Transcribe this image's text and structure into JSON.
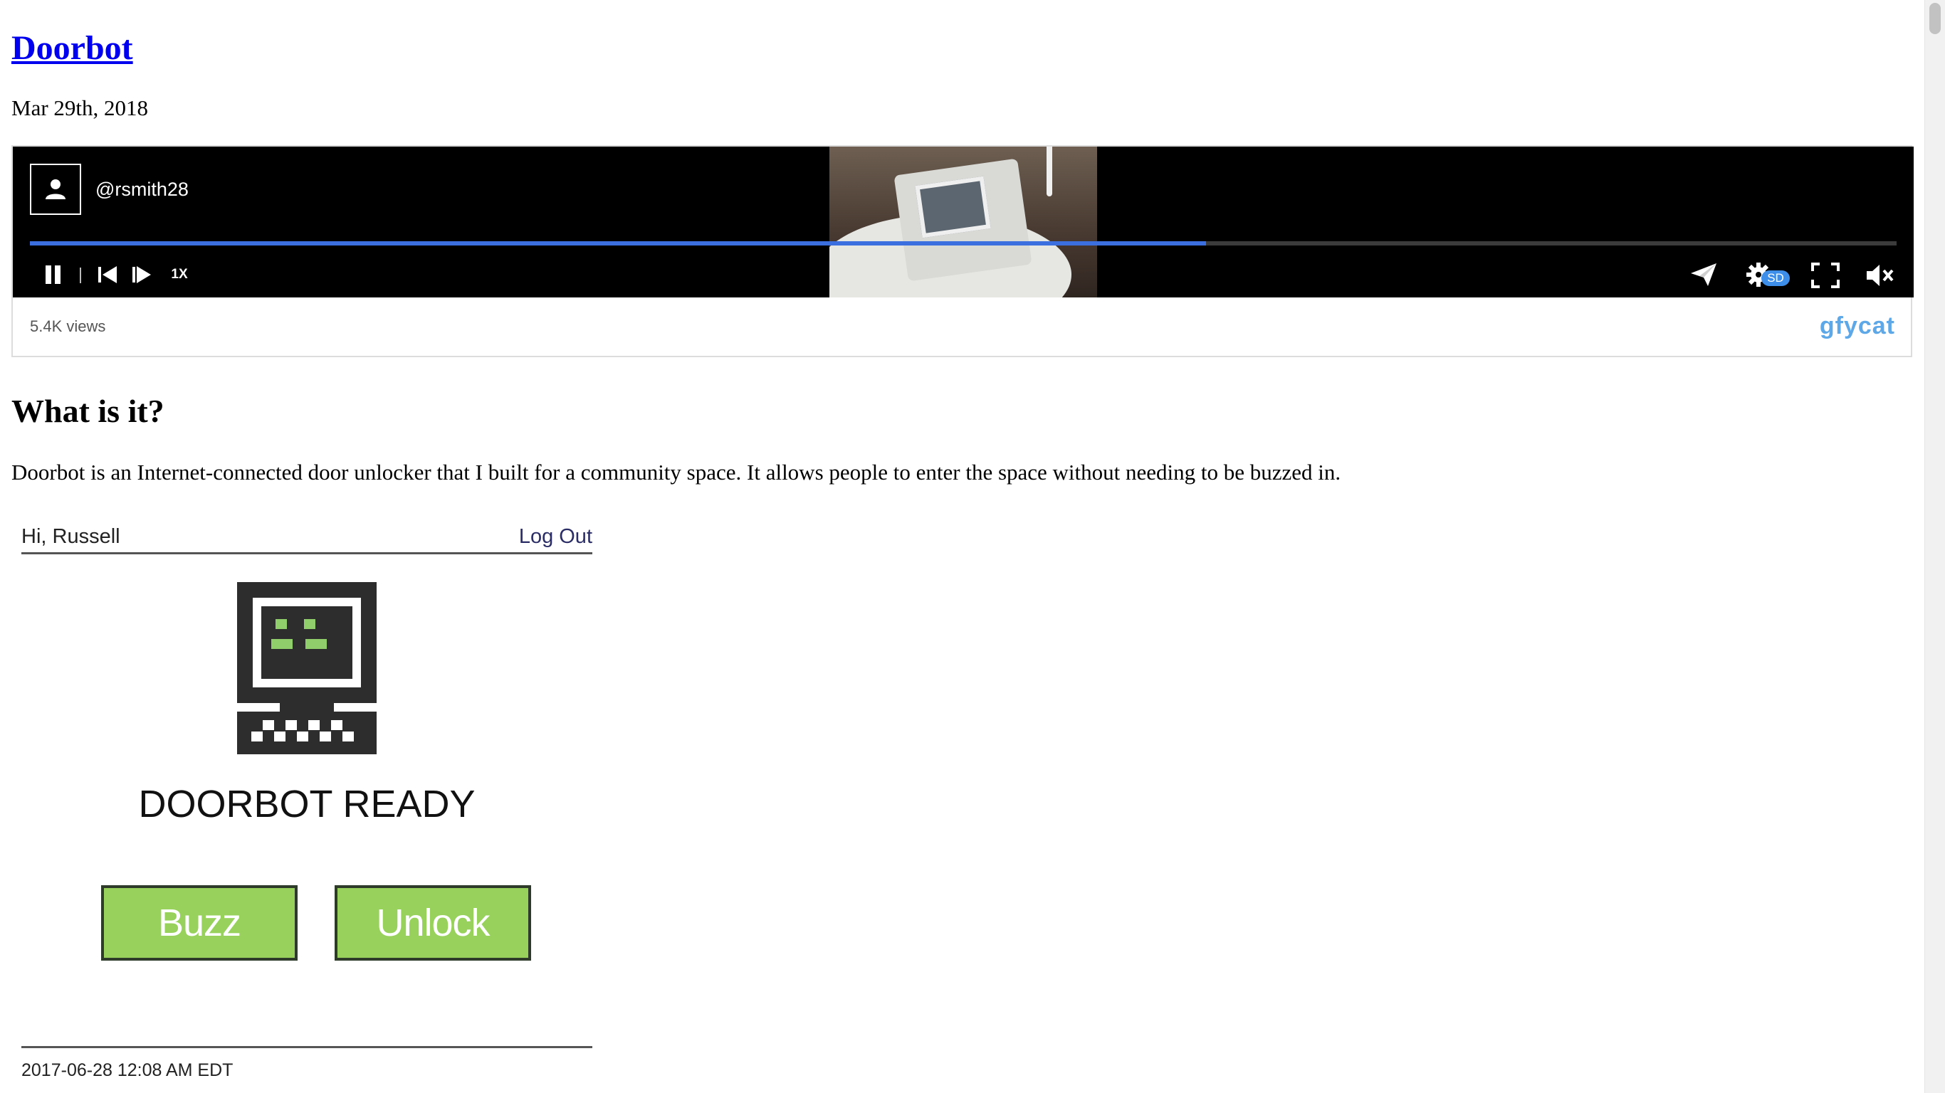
{
  "post": {
    "title": "Doorbot",
    "date": "Mar 29th, 2018"
  },
  "player": {
    "username": "@rsmith28",
    "speed_label": "1X",
    "quality_label": "SD",
    "views_label": "5.4K views",
    "brand": "gfycat",
    "progress_fraction": 0.63,
    "accent_color": "#3b6fe0",
    "icons": [
      "user-icon",
      "pause-icon",
      "step-back-icon",
      "step-forward-icon",
      "share-icon",
      "settings-gear-icon",
      "fullscreen-icon",
      "mute-icon"
    ]
  },
  "section": {
    "heading": "What is it?",
    "paragraph": "Doorbot is an Internet-connected door unlocker that I built for a community space. It allows people to enter the space without needing to be buzzed in."
  },
  "doorbot_ui": {
    "greeting": "Hi, Russell",
    "logout_label": "Log Out",
    "status": "DOORBOT READY",
    "buzz_label": "Buzz",
    "unlock_label": "Unlock",
    "timestamp": "2017-06-28 12:08 AM EDT",
    "button_color": "#98d25c",
    "icons": [
      "robot-computer-icon"
    ]
  }
}
